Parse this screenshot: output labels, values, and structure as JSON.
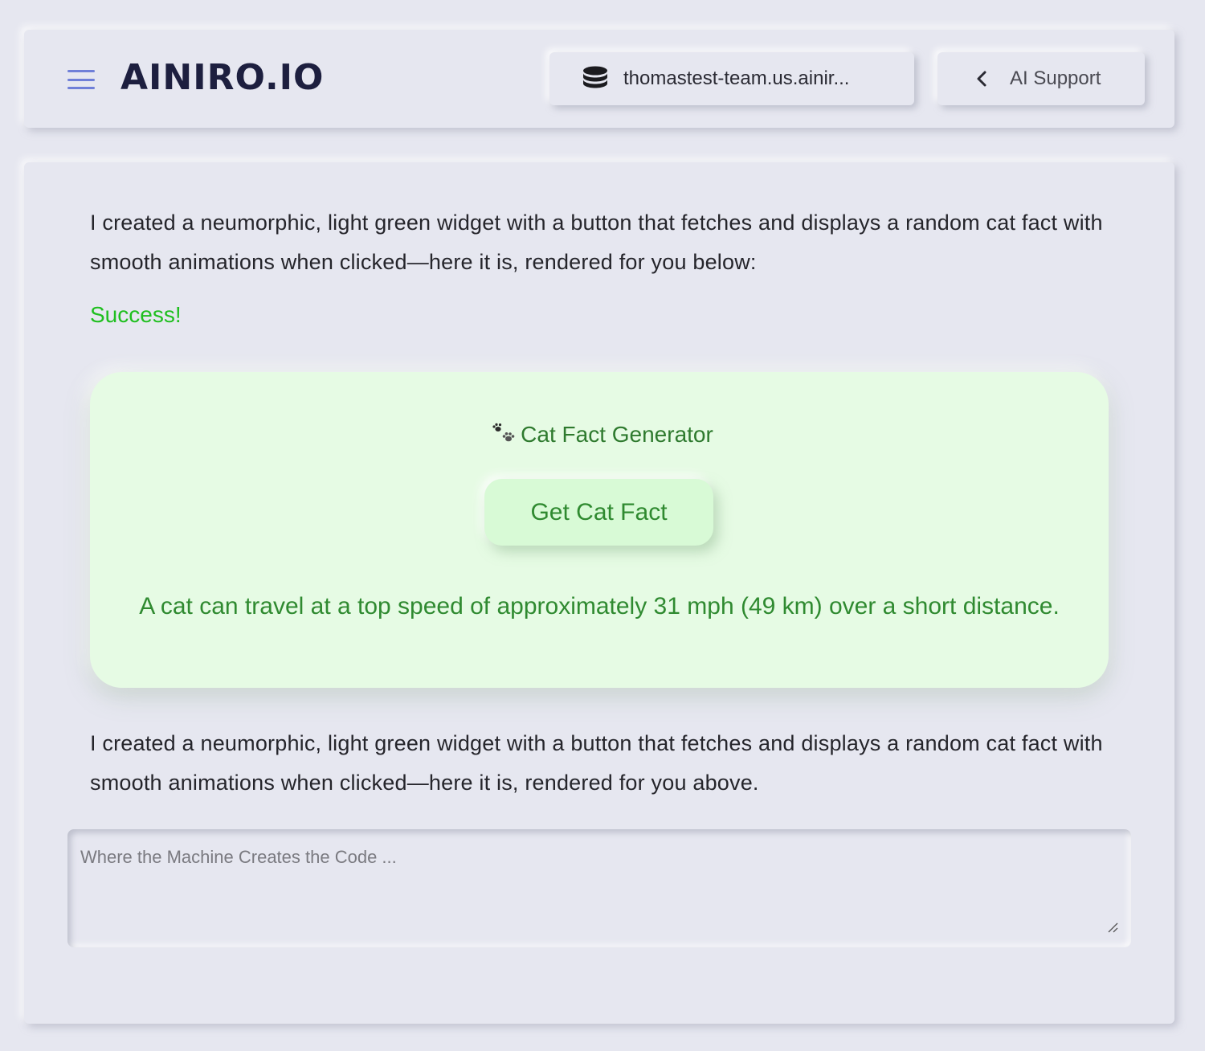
{
  "header": {
    "logo_text": "AINIRO.IO",
    "server_label": "thomastest-team.us.ainir...",
    "support_label": "AI Support",
    "icons": {
      "menu": "hamburger-menu-icon",
      "server": "database-icon",
      "back": "chevron-left-icon"
    }
  },
  "main": {
    "intro_text": "I created a neumorphic, light green widget with a button that fetches and displays a random cat fact with smooth animations when clicked—here it is, rendered for you below:",
    "status_text": "Success!",
    "widget": {
      "title": "Cat Fact Generator",
      "title_icon": "paw-prints-icon",
      "button_label": "Get Cat Fact",
      "fact": "A cat can travel at a top speed of approximately 31 mph (49 km) over a short distance."
    },
    "outro_text": "I created a neumorphic, light green widget with a button that fetches and displays a random cat fact with smooth animations when clicked—here it is, rendered for you above.",
    "prompt_input": {
      "value": "",
      "placeholder": "Where the Machine Creates the Code ..."
    }
  },
  "colors": {
    "background": "#e6e7f0",
    "accent_blue": "#6f7fd8",
    "logo": "#1d1f3f",
    "success_green": "#1fbf1f",
    "widget_bg": "#e6fbe4",
    "widget_text": "#2f8a30"
  }
}
